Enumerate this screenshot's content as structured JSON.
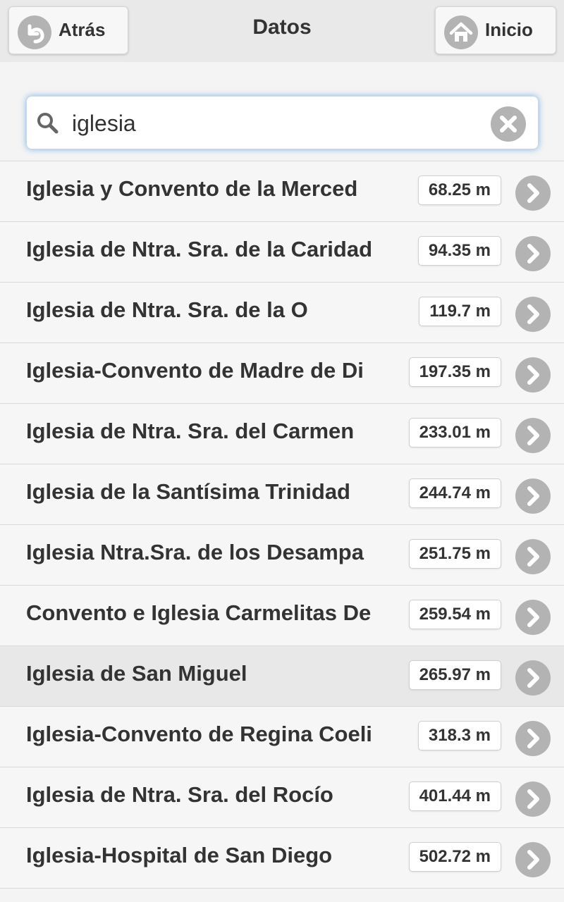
{
  "header": {
    "title": "Datos",
    "back_label": "Atrás",
    "home_label": "Inicio"
  },
  "search": {
    "value": "iglesia"
  },
  "icons": {
    "back": "back-arrow-icon",
    "home": "home-icon",
    "search": "search-icon",
    "clear": "clear-icon",
    "row_arrow": "chevron-right-icon"
  },
  "colors": {
    "icon_gray": "#b3b3b3",
    "focus_glow": "#5aa0e1"
  },
  "items": [
    {
      "name": "Iglesia y Convento de la Merced",
      "distance": "68.25 m"
    },
    {
      "name": "Iglesia de Ntra. Sra. de la Caridad",
      "distance": "94.35 m"
    },
    {
      "name": "Iglesia de Ntra. Sra. de la O",
      "distance": "119.7 m"
    },
    {
      "name": "Iglesia-Convento de Madre de Di",
      "distance": "197.35 m"
    },
    {
      "name": "Iglesia de Ntra. Sra. del Carmen",
      "distance": "233.01 m"
    },
    {
      "name": "Iglesia de la Santísima Trinidad",
      "distance": "244.74 m"
    },
    {
      "name": "Iglesia Ntra.Sra. de los Desampa",
      "distance": "251.75 m"
    },
    {
      "name": "Convento e Iglesia Carmelitas De",
      "distance": "259.54 m"
    },
    {
      "name": "Iglesia de San Miguel",
      "distance": "265.97 m"
    },
    {
      "name": "Iglesia-Convento de Regina Coeli",
      "distance": "318.3 m"
    },
    {
      "name": "Iglesia de Ntra. Sra. del Rocío",
      "distance": "401.44 m"
    },
    {
      "name": "Iglesia-Hospital de San Diego",
      "distance": "502.72 m"
    }
  ]
}
